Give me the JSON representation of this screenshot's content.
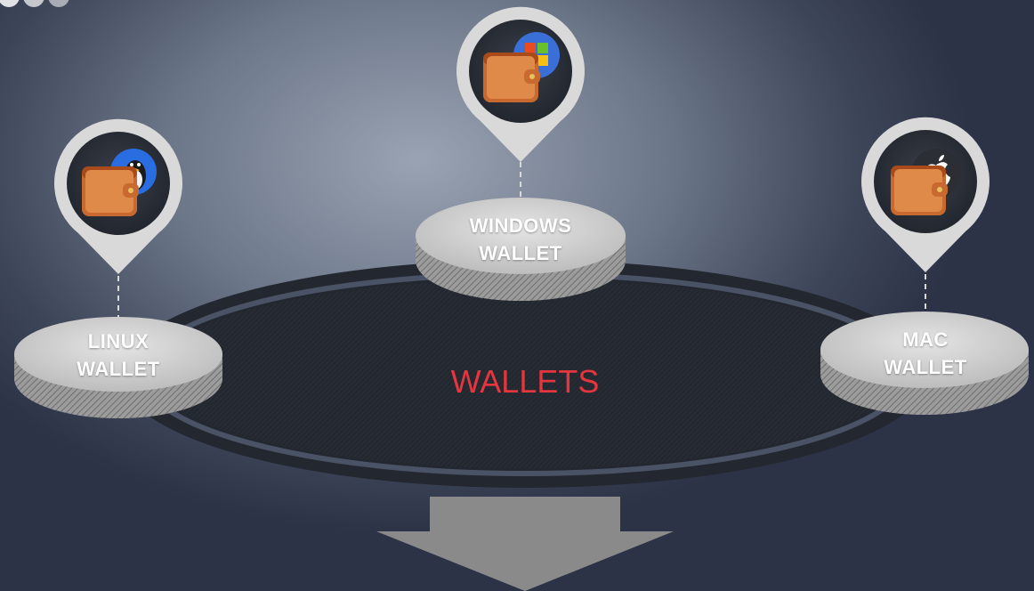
{
  "title": "WALLETS",
  "nodes": [
    {
      "id": "linux",
      "label_line1": "LINUX",
      "label_line2": "WALLET",
      "os_icon": "linux-penguin-icon"
    },
    {
      "id": "windows",
      "label_line1": "WINDOWS",
      "label_line2": "WALLET",
      "os_icon": "windows-logo-icon"
    },
    {
      "id": "mac",
      "label_line1": "MAC",
      "label_line2": "WALLET",
      "os_icon": "apple-logo-icon"
    }
  ],
  "colors": {
    "title": "#e5353d",
    "platform": "#2a2f3c",
    "disc_top": "#d2d2d2",
    "pin": "#d9d9d9",
    "arrow": "#8a8a8a"
  },
  "arrow_direction": "down"
}
